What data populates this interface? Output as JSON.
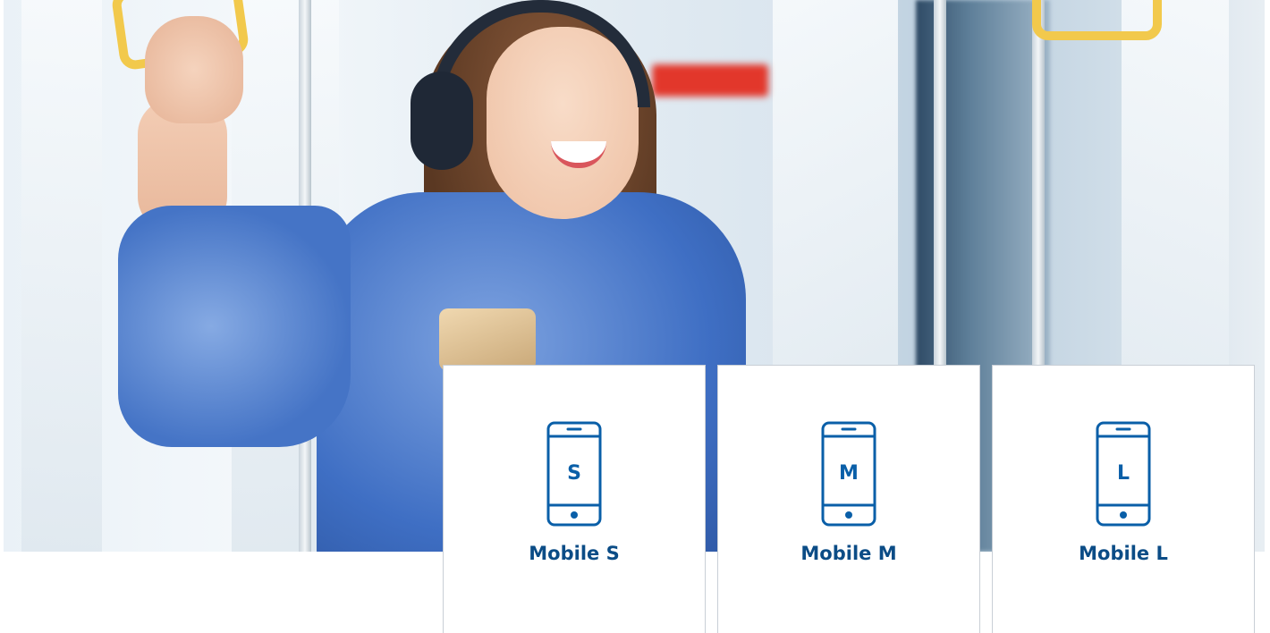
{
  "plans": [
    {
      "letter": "S",
      "name": "Mobile S"
    },
    {
      "letter": "M",
      "name": "Mobile M"
    },
    {
      "letter": "L",
      "name": "Mobile L"
    }
  ],
  "colors": {
    "accent": "#0a5fa8",
    "plan_name": "#0b4c86",
    "card_border": "#c9cfd6",
    "background": "#ffffff"
  },
  "icons": {
    "plan_icon": "smartphone-icon"
  }
}
